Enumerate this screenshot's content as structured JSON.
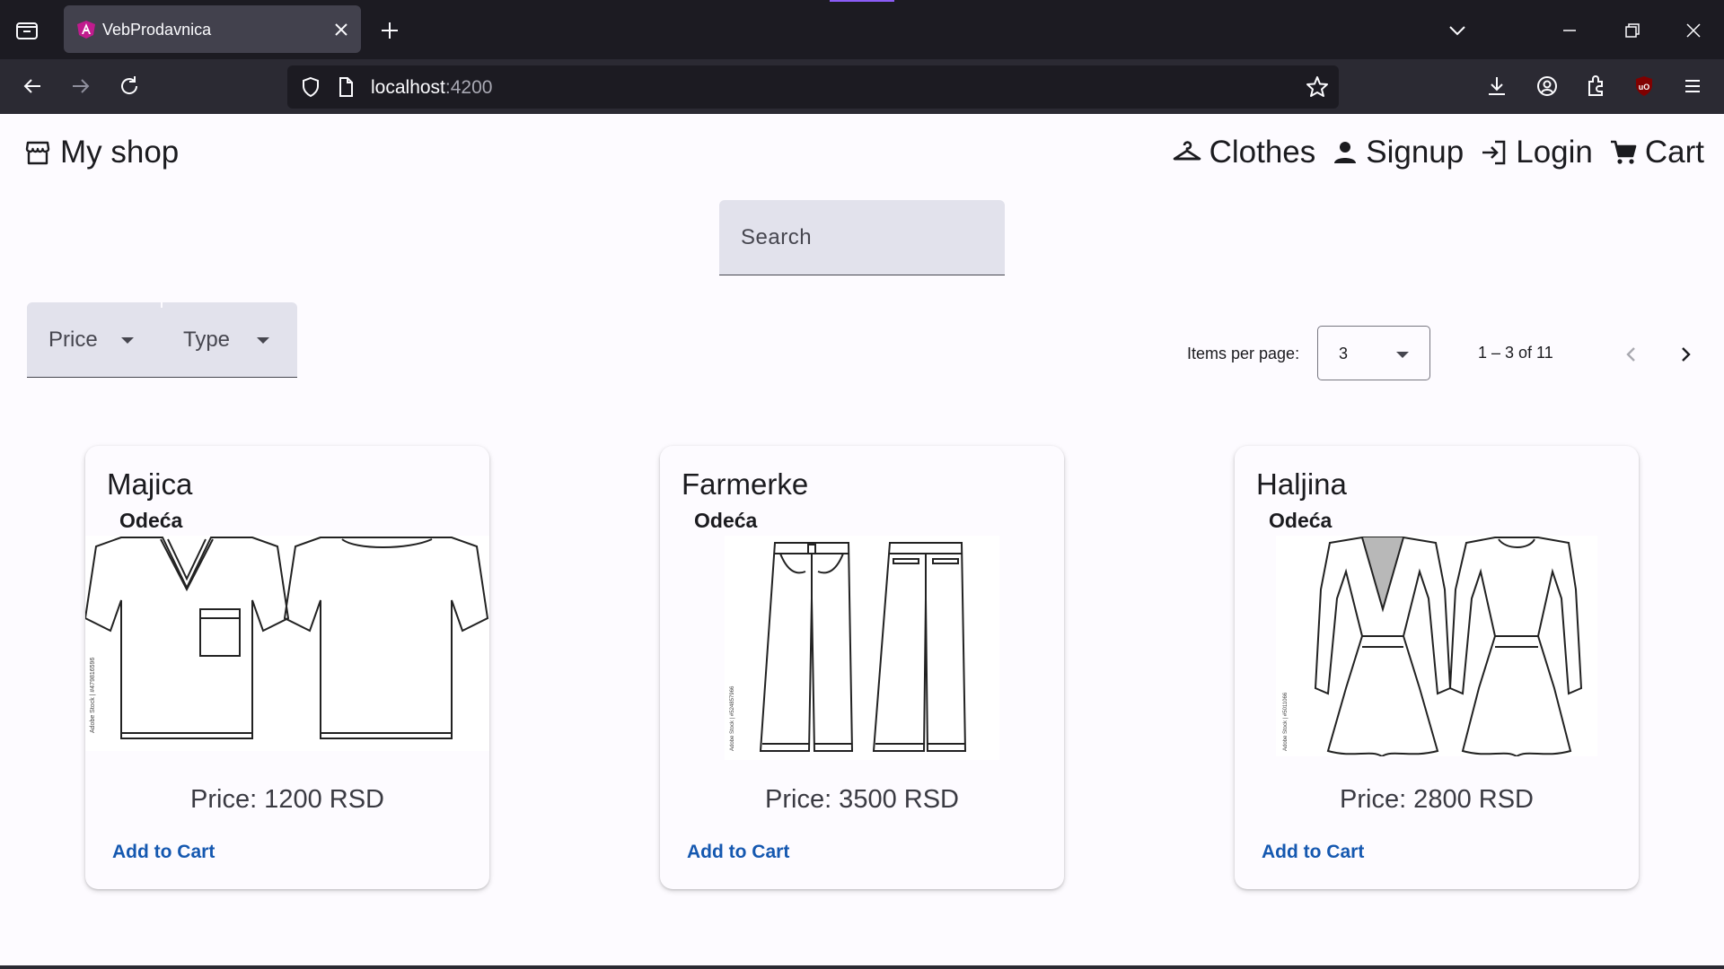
{
  "browser": {
    "tab_title": "VebProdavnica",
    "url_host": "localhost",
    "url_port": ":4200"
  },
  "header": {
    "shop_title": "My shop",
    "nav": [
      {
        "label": "Clothes",
        "icon": "hanger-icon"
      },
      {
        "label": "Signup",
        "icon": "person-icon"
      },
      {
        "label": "Login",
        "icon": "login-icon"
      },
      {
        "label": "Cart",
        "icon": "cart-icon"
      }
    ]
  },
  "search": {
    "placeholder": "Search"
  },
  "filters": {
    "price_label": "Price",
    "type_label": "Type"
  },
  "paginator": {
    "items_per_page_label": "Items per page:",
    "page_size": "3",
    "range_label": "1 – 3 of 11"
  },
  "products": [
    {
      "name": "Majica",
      "type": "Odeća",
      "price": "Price: 1200 RSD",
      "button": "Add to Cart",
      "image": "tshirt-sketch"
    },
    {
      "name": "Farmerke",
      "type": "Odeća",
      "price": "Price: 3500 RSD",
      "button": "Add to Cart",
      "image": "jeans-sketch"
    },
    {
      "name": "Haljina",
      "type": "Odeća",
      "price": "Price: 2800 RSD",
      "button": "Add to Cart",
      "image": "dress-sketch"
    }
  ],
  "colors": {
    "link": "#1558b0",
    "field_bg": "#e2e2ec",
    "chrome_dark": "#1c1b22",
    "chrome": "#2b2a33"
  }
}
